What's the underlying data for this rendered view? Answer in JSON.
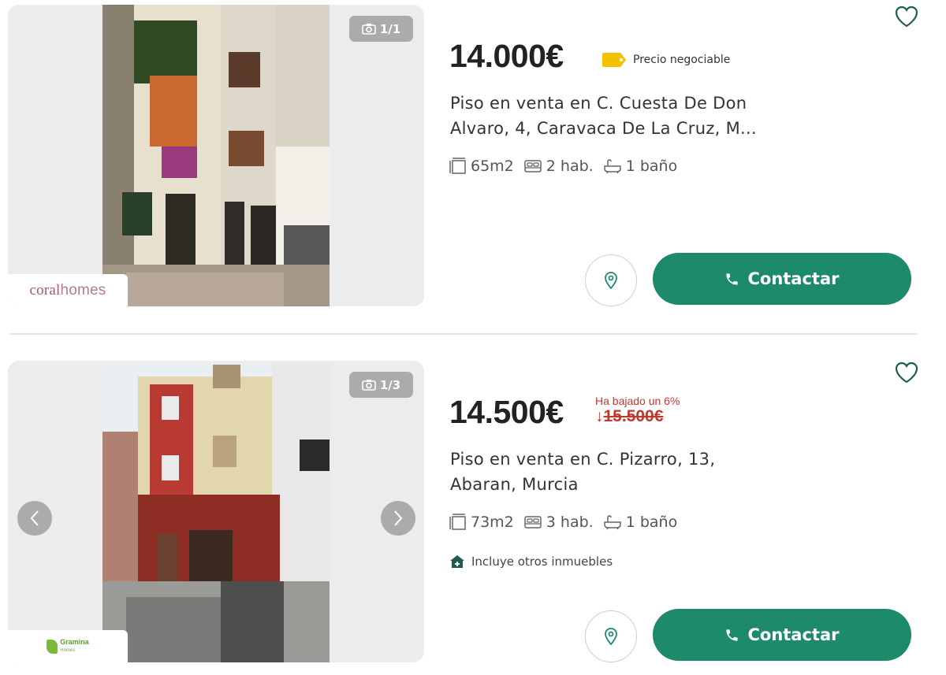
{
  "listings": [
    {
      "price": "14.000€",
      "negotiable_label": "Precio negociable",
      "title_line1": "Piso en venta en C. Cuesta De Don",
      "title_line2": "Alvaro, 4, Caravaca De La Cruz, M...",
      "area": "65m2",
      "rooms": "2 hab.",
      "baths": "1 baño",
      "photo_count": "1/1",
      "agency_part1": "coral",
      "agency_part2": "homes",
      "contact_label": "Contactar",
      "icons": [
        "camera-icon",
        "tag-icon",
        "area-icon",
        "bed-icon",
        "bath-icon",
        "location-pin-icon",
        "phone-icon",
        "heart-icon"
      ]
    },
    {
      "price": "14.500€",
      "drop_note": "Ha bajado un 6%",
      "drop_arrow": "↓",
      "old_price": "15.500€",
      "title_line1": "Piso en venta en C. Pizarro, 13,",
      "title_line2": "Abaran, Murcia",
      "area": "73m2",
      "rooms": "3 hab.",
      "baths": "1 baño",
      "extra_label": "Incluye otros inmuebles",
      "photo_count": "1/3",
      "agency_name": "Gramina",
      "agency_sub": "Homes",
      "contact_label": "Contactar",
      "icons": [
        "camera-icon",
        "chevron-left-icon",
        "chevron-right-icon",
        "area-icon",
        "bed-icon",
        "bath-icon",
        "home-plus-icon",
        "location-pin-icon",
        "phone-icon",
        "heart-icon"
      ]
    }
  ],
  "colors": {
    "accent": "#1d8a6b",
    "price_drop": "#c0392b",
    "tag": "#f2c200"
  }
}
